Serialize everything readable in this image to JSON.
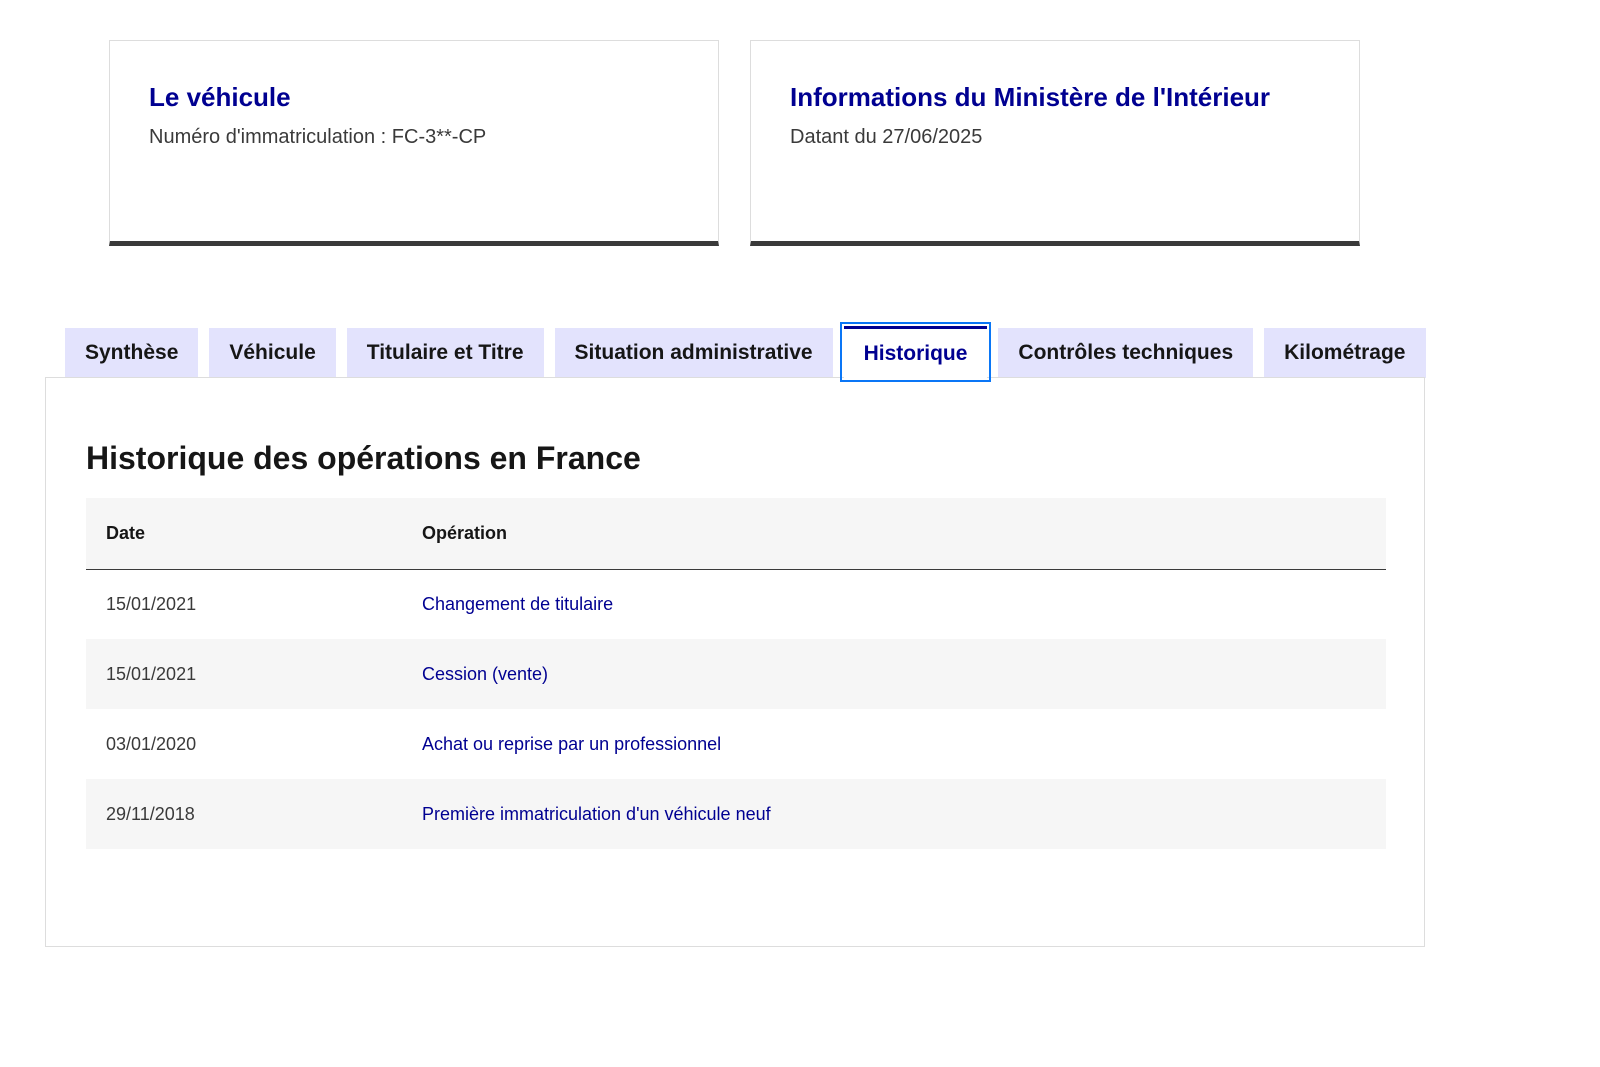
{
  "cards": [
    {
      "title": "Le véhicule",
      "description": "Numéro d'immatriculation : FC-3**-CP"
    },
    {
      "title": "Informations du Ministère de l'Intérieur",
      "description": "Datant du 27/06/2025"
    }
  ],
  "tabs": [
    {
      "label": "Synthèse",
      "selected": false
    },
    {
      "label": "Véhicule",
      "selected": false
    },
    {
      "label": "Titulaire et Titre",
      "selected": false
    },
    {
      "label": "Situation administrative",
      "selected": false
    },
    {
      "label": "Historique",
      "selected": true
    },
    {
      "label": "Contrôles techniques",
      "selected": false
    },
    {
      "label": "Kilométrage",
      "selected": false
    }
  ],
  "panel": {
    "title": "Historique des opérations en France",
    "table": {
      "headers": [
        "Date",
        "Opération"
      ],
      "rows": [
        [
          "15/01/2021",
          "Changement de titulaire"
        ],
        [
          "15/01/2021",
          "Cession (vente)"
        ],
        [
          "03/01/2020",
          "Achat ou reprise par un professionnel"
        ],
        [
          "29/11/2018",
          "Première immatriculation d'un véhicule neuf"
        ]
      ]
    }
  },
  "colors": {
    "accent": "#000091",
    "tab_background": "#e3e3fd",
    "focus_outline": "#0a76f6",
    "row_alt": "#f6f6f6"
  }
}
